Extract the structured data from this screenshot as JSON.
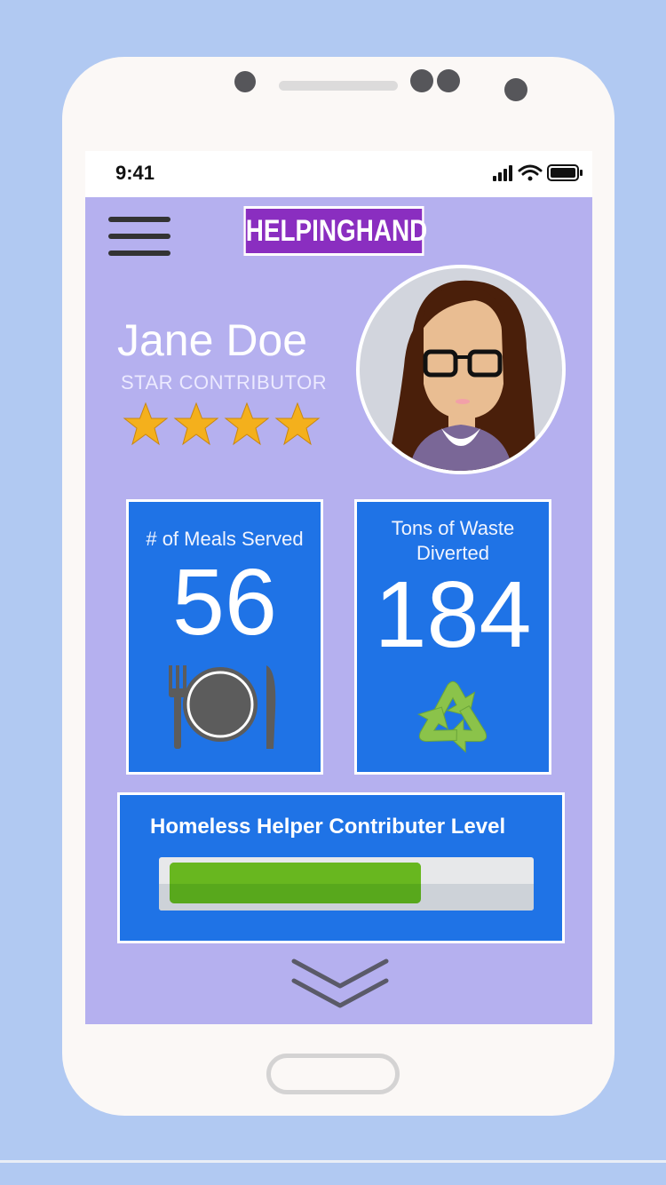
{
  "status_bar": {
    "time": "9:41"
  },
  "header": {
    "brand": "HELPINGHAND"
  },
  "profile": {
    "name": "Jane Doe",
    "rank": "STAR CONTRIBUTOR",
    "rating": 4,
    "rating_max": 4
  },
  "stats": [
    {
      "title": "# of Meals Served",
      "value": "56",
      "icon": "plate-cutlery-icon"
    },
    {
      "title": "Tons of Waste Diverted",
      "value": "184",
      "icon": "recycle-icon"
    }
  ],
  "level": {
    "title": "Homeless Helper Contributer Level",
    "progress": 0.71
  },
  "colors": {
    "background": "#b1c9f2",
    "screen": "#b5b0ef",
    "brand": "#8a2ec0",
    "card": "#1f73e6",
    "progress": "#5fb01e",
    "star": "#f4b01c",
    "recycle": "#8bc34a"
  }
}
